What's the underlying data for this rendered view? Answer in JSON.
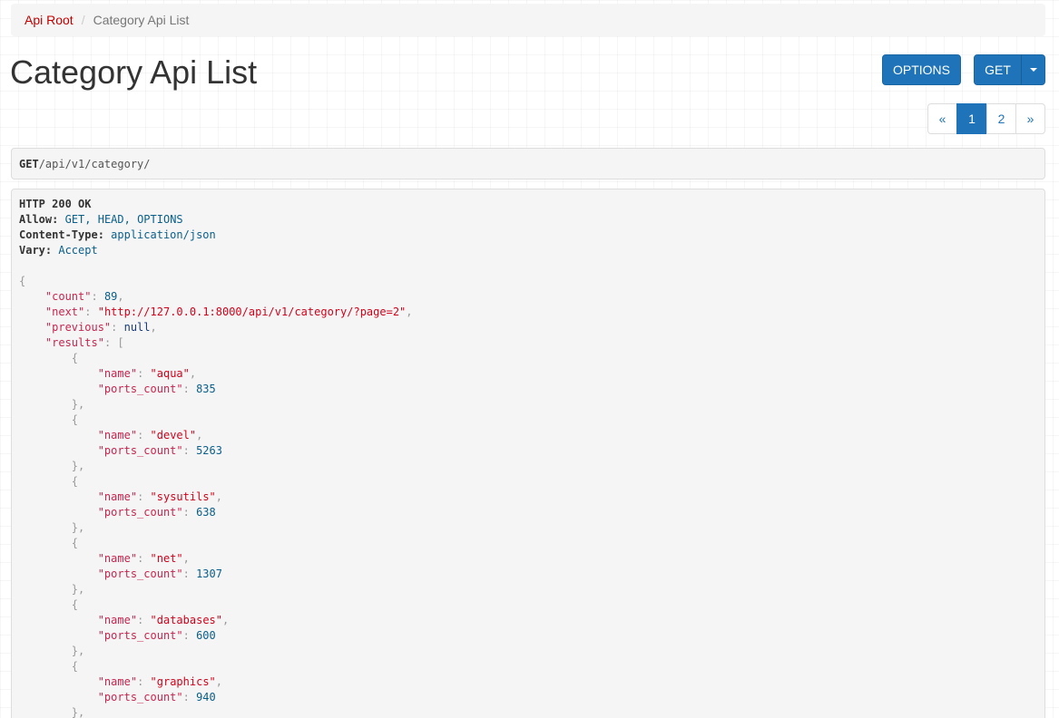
{
  "breadcrumb": {
    "root_label": "Api Root",
    "separator": "/",
    "current_label": "Category Api List"
  },
  "page": {
    "title": "Category Api List"
  },
  "actions": {
    "options_label": "OPTIONS",
    "get_label": "GET",
    "get_dropdown_icon": "caret-down-icon"
  },
  "pagination": {
    "prev_label": "«",
    "pages": [
      "1",
      "2"
    ],
    "current_page": "1",
    "next_label": "»"
  },
  "request": {
    "method": "GET",
    "url": "/api/v1/category/"
  },
  "response": {
    "status": "HTTP 200 OK",
    "headers": [
      {
        "key": "Allow:",
        "value": "GET, HEAD, OPTIONS"
      },
      {
        "key": "Content-Type:",
        "value": "application/json"
      },
      {
        "key": "Vary:",
        "value": "Accept"
      }
    ],
    "body": {
      "count_key": "\"count\"",
      "count": "89",
      "next_key": "\"next\"",
      "next": "\"http://127.0.0.1:8000/api/v1/category/?page=2\"",
      "previous_key": "\"previous\"",
      "previous": "null",
      "results_key": "\"results\"",
      "name_key": "\"name\"",
      "ports_count_key": "\"ports_count\"",
      "results": [
        {
          "name": "\"aqua\"",
          "ports_count": "835"
        },
        {
          "name": "\"devel\"",
          "ports_count": "5263"
        },
        {
          "name": "\"sysutils\"",
          "ports_count": "638"
        },
        {
          "name": "\"net\"",
          "ports_count": "1307"
        },
        {
          "name": "\"databases\"",
          "ports_count": "600"
        },
        {
          "name": "\"graphics\"",
          "ports_count": "940"
        }
      ]
    }
  },
  "colors": {
    "brand_link": "#c20000",
    "button_primary": "#1f74b9",
    "json_key": "#c7254e",
    "json_string": "#d0021b",
    "json_number": "#0a5f8a"
  }
}
